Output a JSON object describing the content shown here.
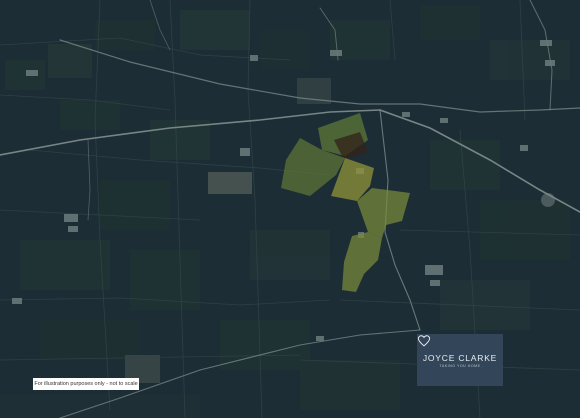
{
  "map": {
    "base_color": "#1e3039",
    "highlight_colors": [
      "#6f8a3a",
      "#8ea13f",
      "#a8aa3c"
    ]
  },
  "disclaimer": {
    "text": "For illustration purposes only - not to scale"
  },
  "brand": {
    "name": "JOYCE CLARKE",
    "tagline": "TAKING YOU HOME",
    "icon": "heart-logo-icon"
  }
}
